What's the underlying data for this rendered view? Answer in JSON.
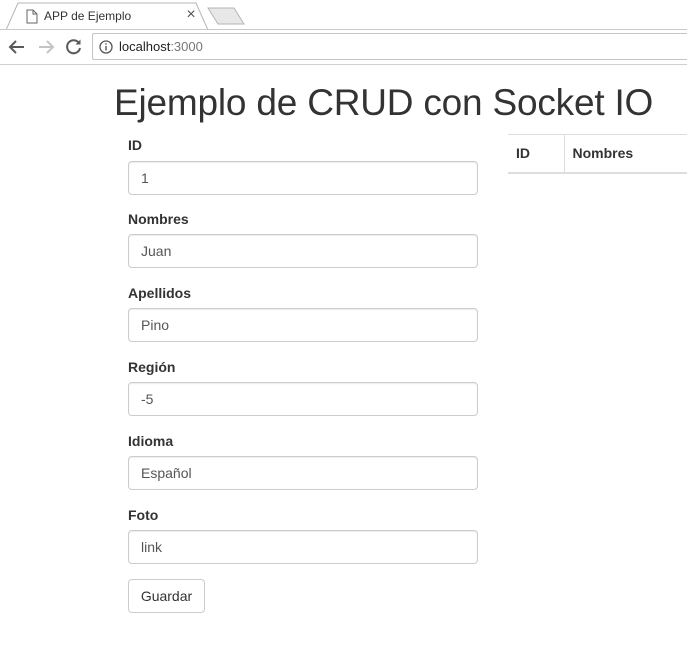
{
  "browser": {
    "tab_title": "APP de Ejemplo",
    "tab_close": "×",
    "url_host": "localhost",
    "url_port": ":3000",
    "icons": {
      "page": "page-icon",
      "close": "close-icon",
      "back": "back-arrow-icon",
      "forward": "forward-arrow-icon",
      "reload": "reload-icon",
      "info": "info-icon"
    }
  },
  "page": {
    "title": "Ejemplo de CRUD con Socket IO"
  },
  "form": {
    "fields": [
      {
        "label": "ID",
        "value": "1"
      },
      {
        "label": "Nombres",
        "value": "Juan"
      },
      {
        "label": "Apellidos",
        "value": "Pino"
      },
      {
        "label": "Región",
        "value": "-5"
      },
      {
        "label": "Idioma",
        "value": "Español"
      },
      {
        "label": "Foto",
        "value": "link"
      }
    ],
    "submit_label": "Guardar"
  },
  "table": {
    "columns": [
      "ID",
      "Nombres"
    ],
    "rows": []
  },
  "colors": {
    "text": "#333333",
    "input_text": "#555555",
    "border": "#cccccc",
    "table_border": "#dddddd"
  }
}
